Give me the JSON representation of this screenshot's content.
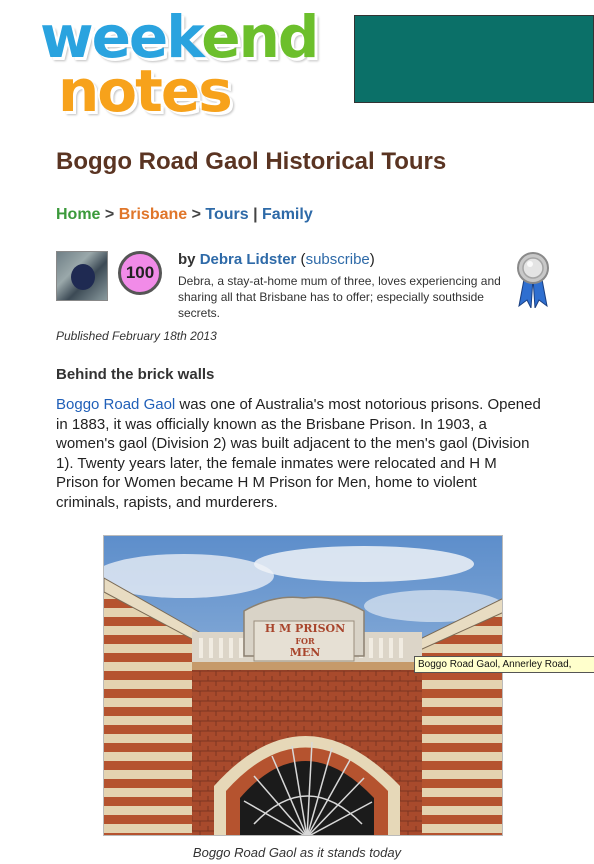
{
  "logo": {
    "line1_a": "week",
    "line1_b": "end",
    "line2": "notes"
  },
  "title": "Boggo Road Gaol Historical Tours",
  "breadcrumb": {
    "home": "Home",
    "sep1": " > ",
    "city": "Brisbane",
    "sep2": " > ",
    "category": "Tours",
    "sep3": " | ",
    "tag": "Family"
  },
  "author": {
    "score": "100",
    "by_label": "by",
    "name": "Debra Lidster",
    "subscribe_open": " (",
    "subscribe": "subscribe",
    "subscribe_close": ")",
    "bio": "Debra, a stay-at-home mum of three, loves experiencing and sharing all that Brisbane has to offer; especially southside secrets."
  },
  "published": "Published February 18th 2013",
  "section_heading": "Behind the brick walls",
  "paragraph": {
    "link": "Boggo Road Gaol",
    "text": " was one of Australia's most notorious prisons. Opened in 1883, it was officially known as the Brisbane Prison. In 1903, a women's gaol (Division 2) was built adjacent to the men's gaol (Division 1). Twenty years later, the female inmates were relocated and H M Prison for Women became H M Prison for Men, home to violent criminals, rapists, and murderers."
  },
  "photo": {
    "sign_line1": "H M PRISON",
    "sign_line2": "FOR",
    "sign_line3": "MEN",
    "tooltip": "Boggo Road Gaol, Annerley Road,",
    "caption": "Boggo Road Gaol as it stands today"
  },
  "colors": {
    "ad": "#0b7068",
    "title": "#5a3422",
    "link": "#2e6aa8",
    "home": "#3b9a3b",
    "city": "#e0762a",
    "score": "#f18be8"
  }
}
